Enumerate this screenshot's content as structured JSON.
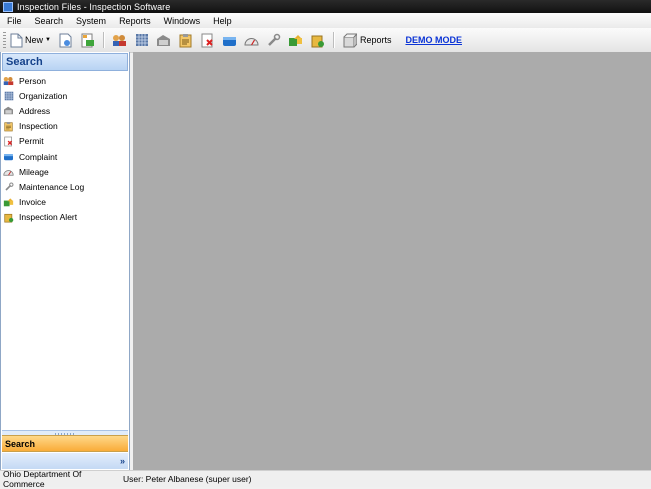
{
  "window": {
    "title": "Inspection Files - Inspection Software"
  },
  "menu": [
    {
      "label": "File"
    },
    {
      "label": "Search"
    },
    {
      "label": "System"
    },
    {
      "label": "Reports"
    },
    {
      "label": "Windows"
    },
    {
      "label": "Help"
    }
  ],
  "toolbar": {
    "new_label": "New",
    "reports_label": "Reports",
    "demo_mode_label": "DEMO MODE",
    "colors": {
      "demo_link": "#0a33d6"
    }
  },
  "search_panel": {
    "title": "Search",
    "items": [
      {
        "label": "Person",
        "icon": "person-icon"
      },
      {
        "label": "Organization",
        "icon": "organization-icon"
      },
      {
        "label": "Address",
        "icon": "address-icon"
      },
      {
        "label": "Inspection",
        "icon": "inspection-icon"
      },
      {
        "label": "Permit",
        "icon": "permit-icon"
      },
      {
        "label": "Complaint",
        "icon": "complaint-icon"
      },
      {
        "label": "Mileage",
        "icon": "mileage-icon"
      },
      {
        "label": "Maintenance Log",
        "icon": "maintenance-icon"
      },
      {
        "label": "Invoice",
        "icon": "invoice-icon"
      },
      {
        "label": "Inspection Alert",
        "icon": "inspection-alert-icon"
      }
    ],
    "selected_button": "Search",
    "colors": {
      "selected_button": "#f9ac39",
      "header_text": "#15428b"
    }
  },
  "status": {
    "organization": "Ohio Deptartment Of Commerce",
    "user": "User: Peter Albanese (super user)"
  }
}
